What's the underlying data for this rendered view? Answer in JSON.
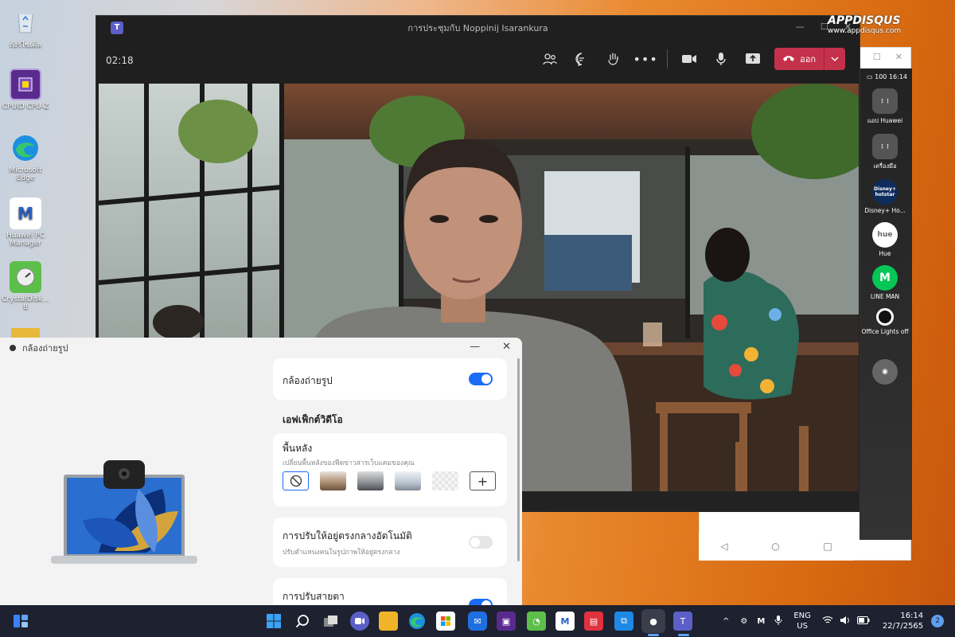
{
  "desktop": {
    "icons": [
      {
        "label": "ถังรีไซเคิล",
        "icon": "recycle-bin-icon"
      },
      {
        "label": "CPUID CPU-Z",
        "icon": "cpu-z-icon"
      },
      {
        "label": "Microsoft Edge",
        "icon": "edge-icon"
      },
      {
        "label": "Huawei PC Manager",
        "icon": "huawei-pc-manager-icon"
      },
      {
        "label": "CrystalDisk... 8",
        "icon": "crystaldisk-icon"
      }
    ],
    "watermark": "www.appdisqus.com",
    "watermark_logo": "APPDISQUS"
  },
  "teams": {
    "title": "การประชุมกับ Noppinij Isarankura",
    "timer": "02:18",
    "leave_label": "ออก",
    "colors": {
      "leave": "#c4314b",
      "bg": "#1f1f1f"
    }
  },
  "phone": {
    "time": "16:14",
    "battery": "100",
    "apps": [
      {
        "label": "แอป Huawei",
        "icon": "huawei-apps-folder-icon"
      },
      {
        "label": "เครื่องมือ",
        "icon": "tools-folder-icon"
      },
      {
        "label": "Disney+ Ho...",
        "icon": "disney-hotstar-icon",
        "short": "Disney+ hotstar"
      },
      {
        "label": "Hue",
        "icon": "hue-icon",
        "short": "hue"
      },
      {
        "label": "LINE MAN",
        "icon": "line-man-icon",
        "short": "M"
      },
      {
        "label": "Office Lights off",
        "icon": "office-lights-icon"
      },
      {
        "label": "",
        "icon": "camera-app-icon"
      }
    ]
  },
  "camera_window": {
    "title": "กล้องถ่ายรูป",
    "camera_toggle_label": "กล้องถ่ายรูป",
    "camera_on": true,
    "section_title": "เอฟเฟ็กต์วิดีโอ",
    "background": {
      "title": "พื้นหลัง",
      "description": "เปลี่ยนพื้นหลังของฟีดข่าวสารเว็บแคมของคุณ",
      "options": [
        "none",
        "room-1",
        "room-2",
        "room-3",
        "blur",
        "add"
      ],
      "selected": "none"
    },
    "auto_center": {
      "title": "การปรับให้อยู่ตรงกลางอัตโนมัติ",
      "description": "ปรับตำแหน่งคนในรูปภาพให้อยู่ตรงกลาง",
      "on": false
    },
    "eye_contact": {
      "title": "การปรับสายตา",
      "on": true
    },
    "accent": "#1a6cf6"
  },
  "taskbar": {
    "language": "ENG",
    "region": "US",
    "time": "16:14",
    "date": "22/7/2565",
    "notifications": "2"
  }
}
